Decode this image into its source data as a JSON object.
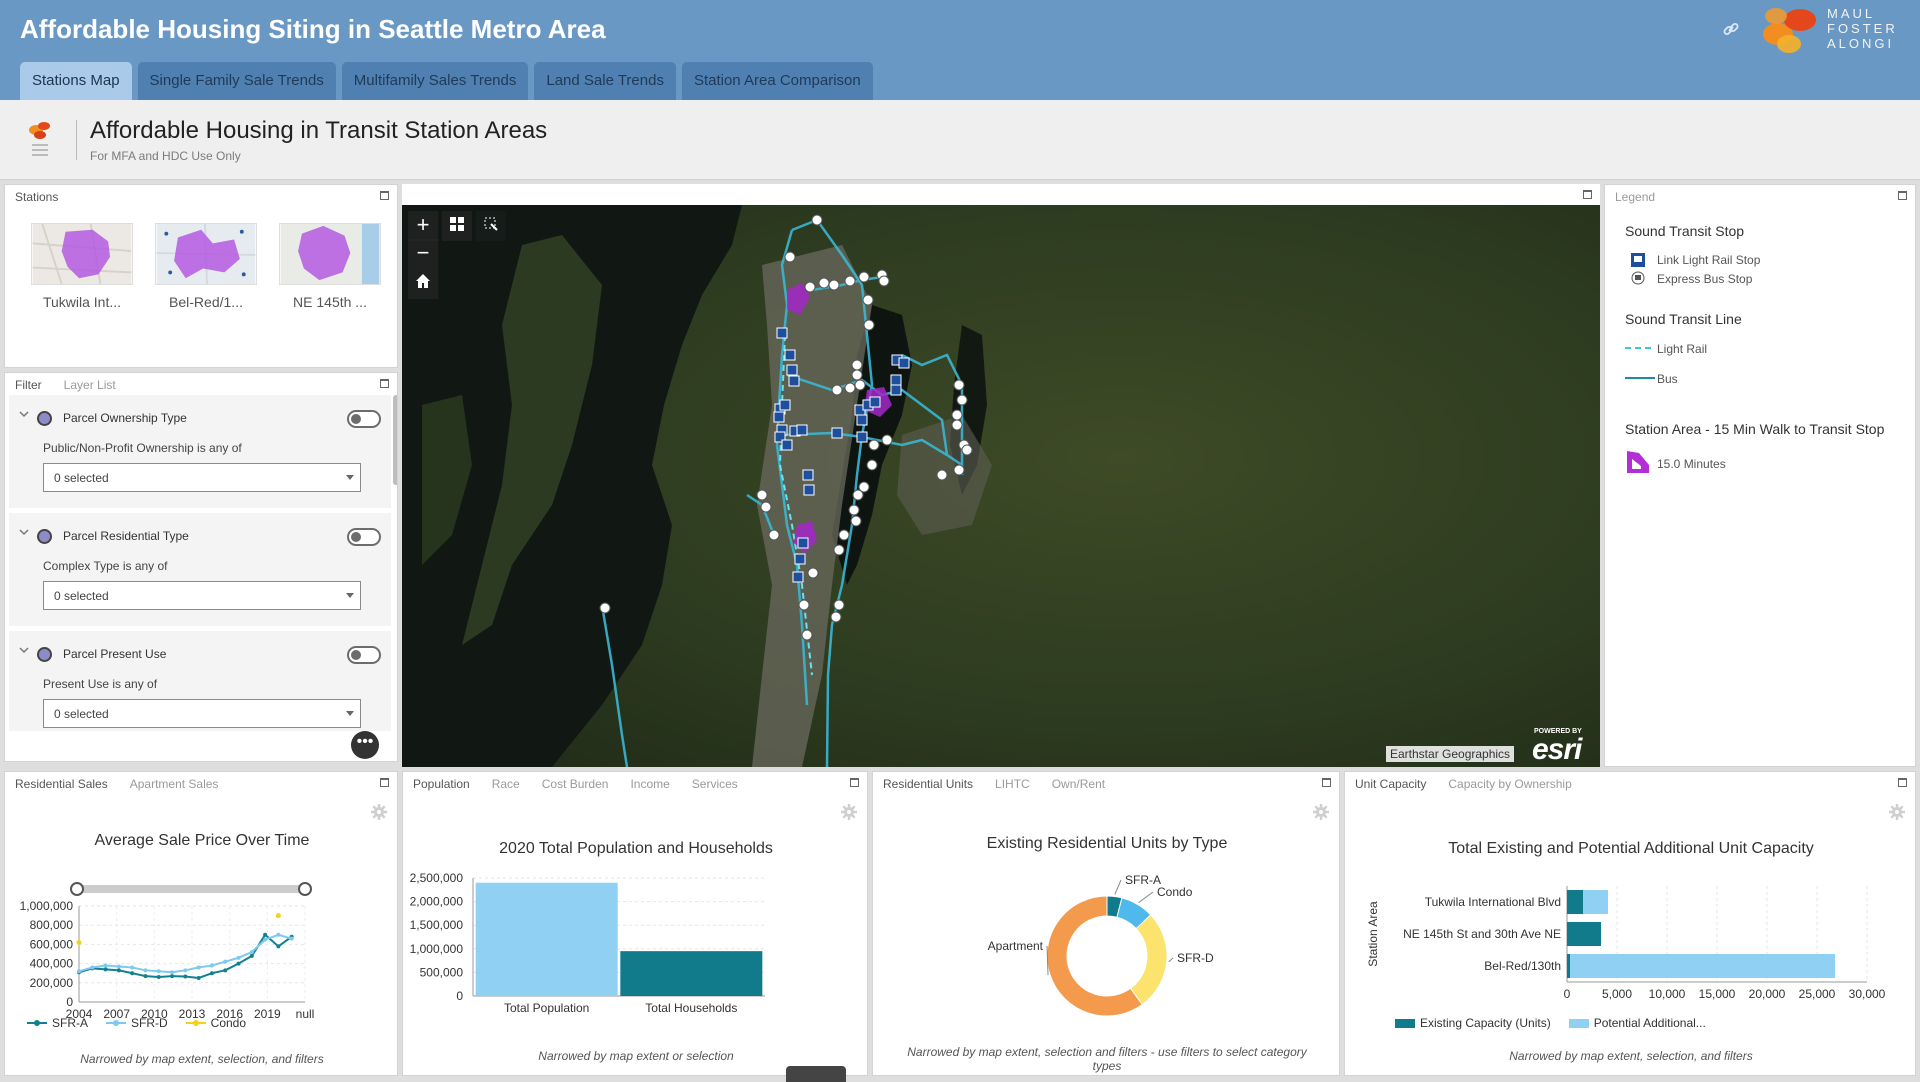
{
  "app": {
    "title": "Affordable Housing Siting in Seattle Metro Area",
    "tabs": [
      "Stations Map",
      "Single Family Sale Trends",
      "Multifamily Sales Trends",
      "Land Sale Trends",
      "Station Area Comparison"
    ],
    "brand": [
      "MAUL",
      "FOSTER",
      "ALONGI"
    ]
  },
  "header": {
    "title": "Affordable Housing in Transit Station Areas",
    "subtitle": "For MFA and HDC Use Only"
  },
  "stations": {
    "panel_title": "Stations",
    "items": [
      "Tukwila Int...",
      "Bel-Red/1...",
      "NE 145th ..."
    ]
  },
  "filter": {
    "tabs": [
      "Filter",
      "Layer List"
    ],
    "groups": [
      {
        "title": "Parcel Ownership Type",
        "label": "Public/Non-Profit Ownership is any of",
        "value": "0 selected"
      },
      {
        "title": "Parcel Residential Type",
        "label": "Complex Type is any of",
        "value": "0 selected"
      },
      {
        "title": "Parcel Present Use",
        "label": "Present Use is any of",
        "value": "0 selected"
      }
    ]
  },
  "map": {
    "attribution": "Earthstar Geographics",
    "esri_tag": "POWERED BY",
    "esri_logo": "esri"
  },
  "legend": {
    "panel_title": "Legend",
    "stop_head": "Sound Transit Stop",
    "rail_stop": "Link Light Rail Stop",
    "bus_stop": "Express Bus Stop",
    "line_head": "Sound Transit Line",
    "rail_line": "Light Rail",
    "bus_line": "Bus",
    "area_head": "Station Area - 15 Min Walk to Transit Stop",
    "area_item": "15.0 Minutes"
  },
  "panels": {
    "sales": {
      "tabs": [
        "Residential Sales",
        "Apartment Sales"
      ],
      "footer": "Narrowed by map extent, selection, and filters"
    },
    "population": {
      "tabs": [
        "Population",
        "Race",
        "Cost Burden",
        "Income",
        "Services"
      ],
      "footer": "Narrowed by map extent or selection"
    },
    "units": {
      "tabs": [
        "Residential Units",
        "LIHTC",
        "Own/Rent"
      ],
      "footer": "Narrowed by map extent, selection and filters - use filters to select category types"
    },
    "capacity": {
      "tabs": [
        "Unit Capacity",
        "Capacity by Ownership"
      ],
      "footer": "Narrowed by map extent, selection, and filters"
    }
  },
  "chart_data": [
    {
      "type": "line",
      "title": "Average Sale Price Over Time",
      "x_ticks": [
        "2004",
        "2007",
        "2010",
        "2013",
        "2016",
        "2019",
        "null"
      ],
      "y_ticks": [
        "1,000,000",
        "800,000",
        "600,000",
        "400,000",
        "200,000",
        "0"
      ],
      "ylim": [
        0,
        1000000
      ],
      "xlim": [
        2004,
        2021
      ],
      "series": [
        {
          "name": "SFR-A",
          "color": "#11818f",
          "x": [
            2004,
            2005,
            2006,
            2007,
            2008,
            2009,
            2010,
            2011,
            2012,
            2013,
            2014,
            2015,
            2016,
            2017,
            2018,
            2019,
            2020
          ],
          "values": [
            310000,
            350000,
            340000,
            330000,
            300000,
            270000,
            260000,
            270000,
            265000,
            250000,
            300000,
            330000,
            400000,
            480000,
            700000,
            580000,
            680000
          ]
        },
        {
          "name": "SFR-D",
          "color": "#7dc9ef",
          "x": [
            2004,
            2005,
            2006,
            2007,
            2008,
            2009,
            2010,
            2011,
            2012,
            2013,
            2014,
            2015,
            2016,
            2017,
            2018,
            2019,
            2020
          ],
          "values": [
            320000,
            360000,
            380000,
            370000,
            360000,
            330000,
            320000,
            310000,
            330000,
            360000,
            380000,
            420000,
            460000,
            520000,
            650000,
            700000,
            660000
          ]
        },
        {
          "name": "Condo",
          "color": "#f2d21b",
          "x": [
            2004,
            2019
          ],
          "values": [
            620000,
            900000
          ]
        }
      ]
    },
    {
      "type": "bar",
      "title": "2020 Total Population and Households",
      "categories": [
        "Total Population",
        "Total Households"
      ],
      "values": [
        2400000,
        950000
      ],
      "colors": [
        "#8fd0f3",
        "#117a8b"
      ],
      "y_ticks": [
        "2,500,000",
        "2,000,000",
        "1,500,000",
        "1,000,000",
        "500,000",
        "0"
      ],
      "ylim": [
        0,
        2500000
      ]
    },
    {
      "type": "pie",
      "title": "Existing Residential Units by Type",
      "labels": [
        "SFR-A",
        "Condo",
        "SFR-D",
        "Apartment"
      ],
      "values": [
        4,
        9,
        27,
        60
      ],
      "colors": [
        "#117a8b",
        "#4fb9ec",
        "#fbe36d",
        "#f39a4d"
      ]
    },
    {
      "type": "bar",
      "orientation": "horizontal",
      "title": "Total Existing and Potential Additional Unit Capacity",
      "ylabel": "Station Area",
      "categories": [
        "Tukwila International Blvd",
        "NE 145th St and 30th Ave NE",
        "Bel-Red/130th"
      ],
      "series": [
        {
          "name": "Existing Capacity (Units)",
          "color": "#117a8b",
          "values": [
            1600,
            3400,
            300
          ]
        },
        {
          "name": "Potential Additional...",
          "color": "#8fd0f3",
          "values": [
            2500,
            0,
            26500
          ]
        }
      ],
      "x_ticks": [
        "0",
        "5,000",
        "10,000",
        "15,000",
        "20,000",
        "25,000",
        "30,000"
      ],
      "xlim": [
        0,
        30000
      ]
    }
  ]
}
